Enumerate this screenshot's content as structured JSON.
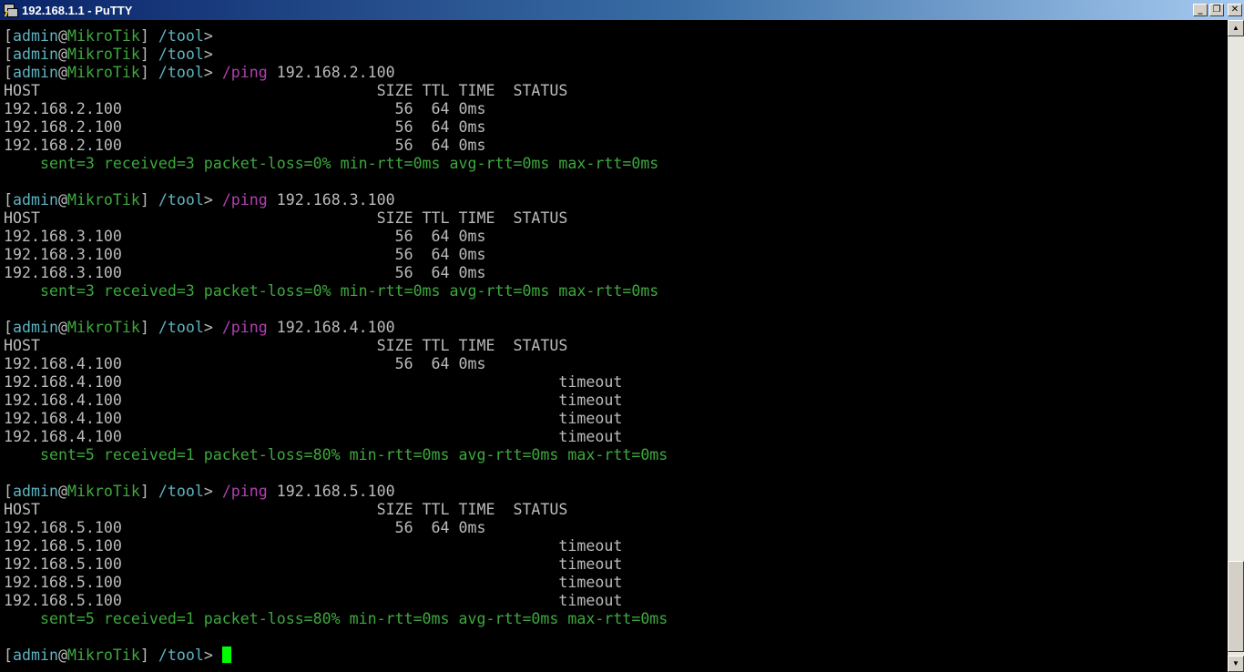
{
  "window": {
    "title": "192.168.1.1 - PuTTY"
  },
  "window_buttons": {
    "minimize": "_",
    "maximize": "❐",
    "close": "✕"
  },
  "scrollbar": {
    "up": "▲",
    "down": "▼"
  },
  "colors": {
    "default": "#bbbbbb",
    "cyan": "#5eb3c2",
    "green": "#3ea83e",
    "magenta": "#b040b0",
    "cursor": "#00ff00"
  },
  "terminal": {
    "lines": [
      [
        [
          "[",
          "d"
        ],
        [
          "admin",
          "c"
        ],
        [
          "@",
          "d"
        ],
        [
          "MikroTik",
          "g"
        ],
        [
          "] ",
          "d"
        ],
        [
          "/tool",
          "c"
        ],
        [
          ">",
          "d"
        ]
      ],
      [
        [
          "[",
          "d"
        ],
        [
          "admin",
          "c"
        ],
        [
          "@",
          "d"
        ],
        [
          "MikroTik",
          "g"
        ],
        [
          "] ",
          "d"
        ],
        [
          "/tool",
          "c"
        ],
        [
          ">",
          "d"
        ]
      ],
      [
        [
          "[",
          "d"
        ],
        [
          "admin",
          "c"
        ],
        [
          "@",
          "d"
        ],
        [
          "MikroTik",
          "g"
        ],
        [
          "] ",
          "d"
        ],
        [
          "/tool",
          "c"
        ],
        [
          "> ",
          "d"
        ],
        [
          "/ping",
          "m"
        ],
        [
          " 192.168.2.100",
          "d"
        ]
      ],
      [
        [
          "HOST                                     SIZE TTL TIME  STATUS",
          "d"
        ]
      ],
      [
        [
          "192.168.2.100                              56  64 0ms",
          "d"
        ]
      ],
      [
        [
          "192.168.2.100                              56  64 0ms",
          "d"
        ]
      ],
      [
        [
          "192.168.2.100                              56  64 0ms",
          "d"
        ]
      ],
      [
        [
          "    sent=3 received=3 packet-loss=0% min-rtt=0ms avg-rtt=0ms max-rtt=0ms",
          "g"
        ]
      ],
      [],
      [
        [
          "[",
          "d"
        ],
        [
          "admin",
          "c"
        ],
        [
          "@",
          "d"
        ],
        [
          "MikroTik",
          "g"
        ],
        [
          "] ",
          "d"
        ],
        [
          "/tool",
          "c"
        ],
        [
          "> ",
          "d"
        ],
        [
          "/ping",
          "m"
        ],
        [
          " 192.168.3.100",
          "d"
        ]
      ],
      [
        [
          "HOST                                     SIZE TTL TIME  STATUS",
          "d"
        ]
      ],
      [
        [
          "192.168.3.100                              56  64 0ms",
          "d"
        ]
      ],
      [
        [
          "192.168.3.100                              56  64 0ms",
          "d"
        ]
      ],
      [
        [
          "192.168.3.100                              56  64 0ms",
          "d"
        ]
      ],
      [
        [
          "    sent=3 received=3 packet-loss=0% min-rtt=0ms avg-rtt=0ms max-rtt=0ms",
          "g"
        ]
      ],
      [],
      [
        [
          "[",
          "d"
        ],
        [
          "admin",
          "c"
        ],
        [
          "@",
          "d"
        ],
        [
          "MikroTik",
          "g"
        ],
        [
          "] ",
          "d"
        ],
        [
          "/tool",
          "c"
        ],
        [
          "> ",
          "d"
        ],
        [
          "/ping",
          "m"
        ],
        [
          " 192.168.4.100",
          "d"
        ]
      ],
      [
        [
          "HOST                                     SIZE TTL TIME  STATUS",
          "d"
        ]
      ],
      [
        [
          "192.168.4.100                              56  64 0ms",
          "d"
        ]
      ],
      [
        [
          "192.168.4.100                                                timeout",
          "d"
        ]
      ],
      [
        [
          "192.168.4.100                                                timeout",
          "d"
        ]
      ],
      [
        [
          "192.168.4.100                                                timeout",
          "d"
        ]
      ],
      [
        [
          "192.168.4.100                                                timeout",
          "d"
        ]
      ],
      [
        [
          "    sent=5 received=1 packet-loss=80% min-rtt=0ms avg-rtt=0ms max-rtt=0ms",
          "g"
        ]
      ],
      [],
      [
        [
          "[",
          "d"
        ],
        [
          "admin",
          "c"
        ],
        [
          "@",
          "d"
        ],
        [
          "MikroTik",
          "g"
        ],
        [
          "] ",
          "d"
        ],
        [
          "/tool",
          "c"
        ],
        [
          "> ",
          "d"
        ],
        [
          "/ping",
          "m"
        ],
        [
          " 192.168.5.100",
          "d"
        ]
      ],
      [
        [
          "HOST                                     SIZE TTL TIME  STATUS",
          "d"
        ]
      ],
      [
        [
          "192.168.5.100                              56  64 0ms",
          "d"
        ]
      ],
      [
        [
          "192.168.5.100                                                timeout",
          "d"
        ]
      ],
      [
        [
          "192.168.5.100                                                timeout",
          "d"
        ]
      ],
      [
        [
          "192.168.5.100                                                timeout",
          "d"
        ]
      ],
      [
        [
          "192.168.5.100                                                timeout",
          "d"
        ]
      ],
      [
        [
          "    sent=5 received=1 packet-loss=80% min-rtt=0ms avg-rtt=0ms max-rtt=0ms",
          "g"
        ]
      ],
      [],
      [
        [
          "[",
          "d"
        ],
        [
          "admin",
          "c"
        ],
        [
          "@",
          "d"
        ],
        [
          "MikroTik",
          "g"
        ],
        [
          "] ",
          "d"
        ],
        [
          "/tool",
          "c"
        ],
        [
          "> ",
          "d"
        ]
      ]
    ]
  }
}
